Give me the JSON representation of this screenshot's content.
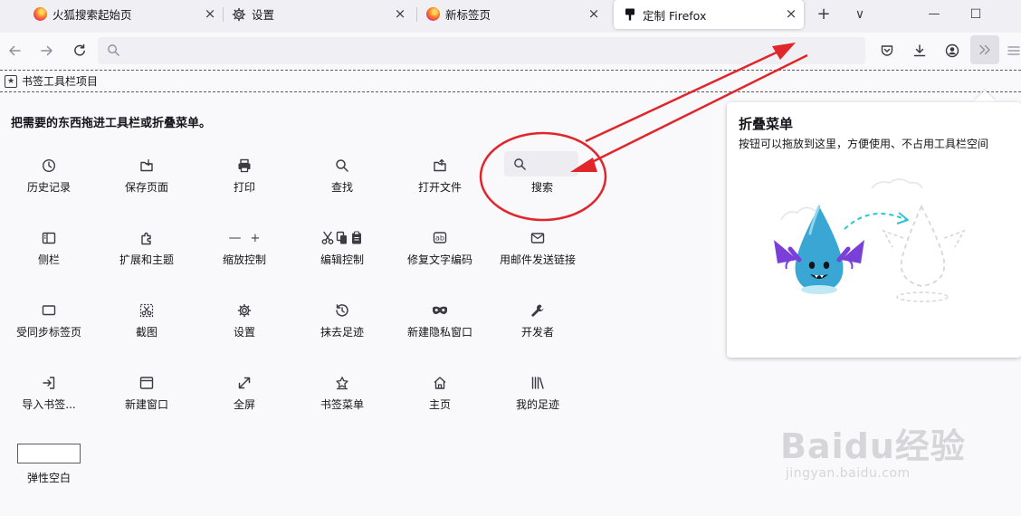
{
  "tabs": [
    {
      "title": "火狐搜索起始页",
      "icon": "firefox-icon",
      "active": false
    },
    {
      "title": "设置",
      "icon": "gear-icon",
      "active": false
    },
    {
      "title": "新标签页",
      "icon": "firefox-icon",
      "active": false
    },
    {
      "title": "定制 Firefox",
      "icon": "customize-icon",
      "active": true
    }
  ],
  "tab_controls": {
    "new_tab": "+",
    "list_tabs": "∨",
    "minimize": "—",
    "maximize": "☐"
  },
  "bookmarks_toolbar": {
    "label": "书签工具栏项目"
  },
  "headline": "把需要的东西拖进工具栏或折叠菜单。",
  "palette": {
    "items": [
      "历史记录",
      "保存页面",
      "打印",
      "查找",
      "打开文件",
      "搜索",
      "侧栏",
      "扩展和主题",
      "缩放控制",
      "编辑控制",
      "修复文字编码",
      "用邮件发送链接",
      "受同步标签页",
      "截图",
      "设置",
      "抹去足迹",
      "新建隐私窗口",
      "开发者",
      "导入书签...",
      "新建窗口",
      "全屏",
      "书签菜单",
      "主页",
      "我的足迹",
      "弹性空白"
    ],
    "zoom_minus": "—",
    "zoom_plus": "+"
  },
  "overflow_panel": {
    "title": "折叠菜单",
    "description": "按钮可以拖放到这里，方便使用、不占用工具栏空间"
  },
  "watermark": {
    "brand": "Baidu经验",
    "url": "jingyan.baidu.com"
  },
  "colors": {
    "annotation_red": "#e0262b",
    "accent_cyan": "#2bc5d6",
    "dragon_body": "#39a6d3"
  }
}
